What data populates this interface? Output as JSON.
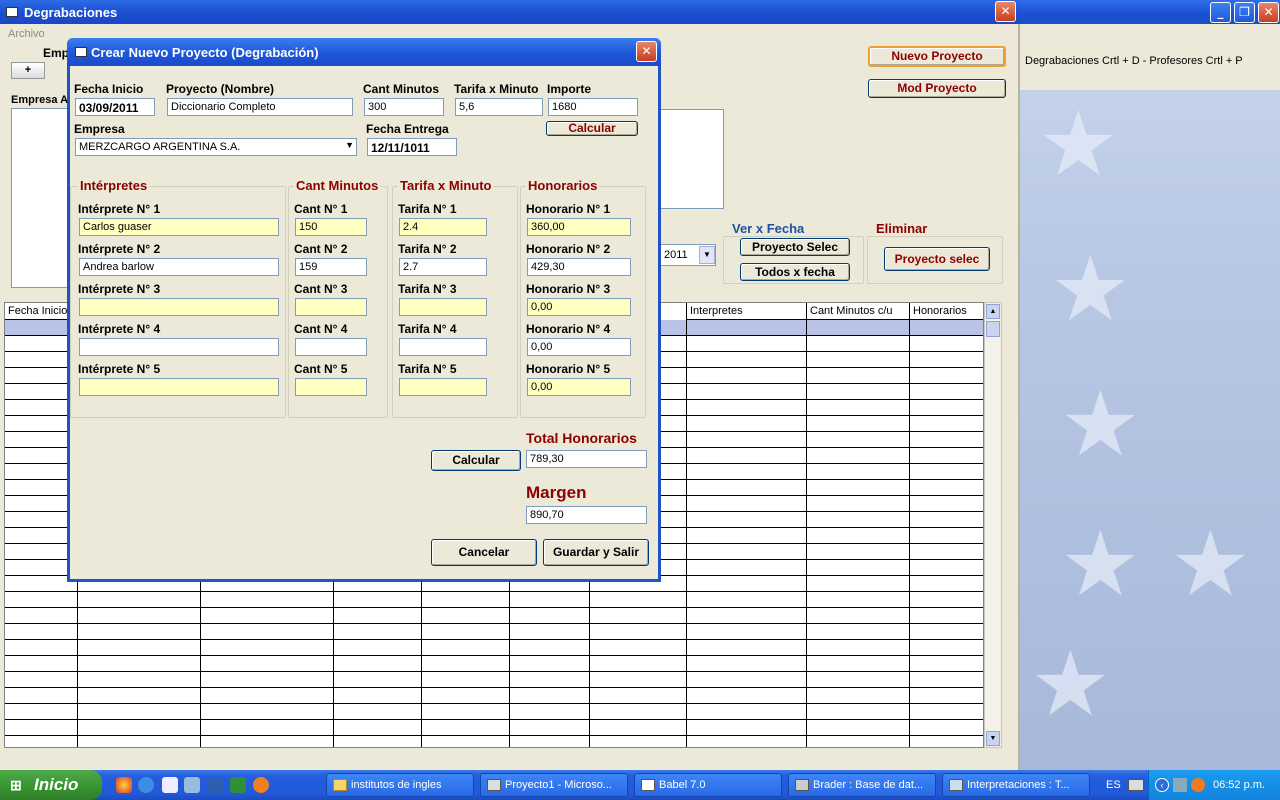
{
  "main_window": {
    "title": "Degrabaciones",
    "menu": [
      "Archivo"
    ],
    "emp_label": "Emp",
    "tab_add": "+",
    "empresa_label": "Empresa A",
    "nuevo_proyecto": "Nuevo Proyecto",
    "mod_proyecto": "Mod  Proyecto",
    "ver_fecha_title": "Ver x Fecha",
    "proyecto_selec": "Proyecto Selec",
    "todos_fecha": "Todos x fecha",
    "eliminar_title": "Eliminar",
    "proyecto_selec_elim": "Proyecto  selec",
    "year_combo": "2011",
    "grid_headers": [
      "Fecha Inicio",
      "",
      "",
      "",
      "",
      "",
      "",
      "Interpretes",
      "Cant Minutos c/u",
      "Honorarios"
    ]
  },
  "side_window": {
    "shortcuts": "Degrabaciones  Crtl + D     -     Profesores Crtl + P"
  },
  "dialog": {
    "title": "Crear Nuevo Proyecto (Degrabación)",
    "fecha_inicio_label": "Fecha Inicio",
    "fecha_inicio": "03/09/2011",
    "proyecto_label": "Proyecto (Nombre)",
    "proyecto": "Diccionario Completo",
    "cant_minutos_label": "Cant  Minutos",
    "cant_minutos": "300",
    "tarifa_label": "Tarifa x Minuto",
    "tarifa": "5,6",
    "importe_label": "Importe",
    "importe": "1680",
    "calcular_top": "Calcular",
    "empresa_label": "Empresa",
    "empresa": "MERZCARGO ARGENTINA S.A.",
    "fecha_entrega_label": "Fecha Entrega",
    "fecha_entrega": "12/11/1011",
    "interpretes_title": "Intérpretes",
    "cant_title": "Cant Minutos",
    "tarifa_title": "Tarifa x Minuto",
    "honorarios_title": "Honorarios",
    "rows": [
      {
        "int_label": "Intérprete N° 1",
        "int": "Carlos guaser",
        "cant_label": "Cant N° 1",
        "cant": "150",
        "tar_label": "Tarifa  N° 1",
        "tar": "2.4",
        "hon_label": "Honorario  N° 1",
        "hon": "360,00"
      },
      {
        "int_label": "Intérprete N° 2",
        "int": "Andrea barlow",
        "cant_label": "Cant N° 2",
        "cant": "159",
        "tar_label": "Tarifa  N° 2",
        "tar": "2.7",
        "hon_label": "Honorario N° 2",
        "hon": "429,30"
      },
      {
        "int_label": "Intérprete N° 3",
        "int": "",
        "cant_label": "Cant N° 3",
        "cant": "",
        "tar_label": "Tarifa  N° 3",
        "tar": "",
        "hon_label": "Honorario N° 3",
        "hon": "0,00"
      },
      {
        "int_label": "Intérprete N° 4",
        "int": "",
        "cant_label": "Cant N° 4",
        "cant": "",
        "tar_label": "Tarifa  N° 4",
        "tar": "",
        "hon_label": "Honorario N° 4",
        "hon": "0,00"
      },
      {
        "int_label": "Intérprete N° 5",
        "int": "",
        "cant_label": "Cant N° 5",
        "cant": "",
        "tar_label": "Tarifa  N° 5",
        "tar": "",
        "hon_label": "Honorario N° 5",
        "hon": "0,00"
      }
    ],
    "calcular_bottom": "Calcular",
    "total_label": "Total Honorarios",
    "total": "789,30",
    "margen_label": "Margen",
    "margen": "890,70",
    "cancelar": "Cancelar",
    "guardar": "Guardar y Salir"
  },
  "taskbar": {
    "start": "Inicio",
    "tasks": [
      "institutos de ingles",
      "Proyecto1 - Microso...",
      "Babel 7.0",
      "Brader : Base de dat...",
      "Interpretaciones : T..."
    ],
    "lang": "ES",
    "clock": "06:52 p.m."
  }
}
